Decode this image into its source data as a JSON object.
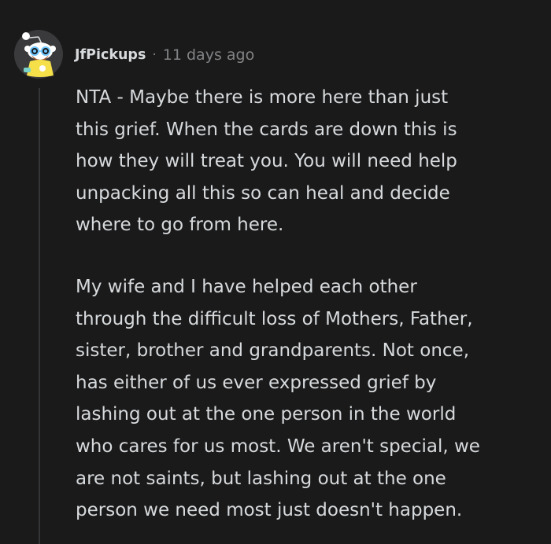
{
  "comment": {
    "username": "JfPickups",
    "separator": "·",
    "timestamp": "11 days ago",
    "avatar_icon": "snoo-avatar-icon",
    "paragraphs": [
      "NTA - Maybe there is more here than just\nthis grief. When the cards are down this is\nhow they will treat you. You will need help\nunpacking all this so can heal and decide\nwhere to go from here.",
      "My wife and I have helped each other\nthrough the difficult loss of Mothers, Father,\nsister, brother and grandparents. Not once,\nhas either of us ever expressed grief by\nlashing out at the one person in the world\nwho cares for us most. We aren't special, we\nare not saints, but lashing out at the one\nperson we need most just doesn't happen."
    ]
  },
  "colors": {
    "background": "#1a1a1b",
    "text": "#d7dadc",
    "meta": "#818384",
    "thread_line": "#343536",
    "avatar_bg": "#3a3a3c",
    "shirt": "#f5e04a"
  }
}
